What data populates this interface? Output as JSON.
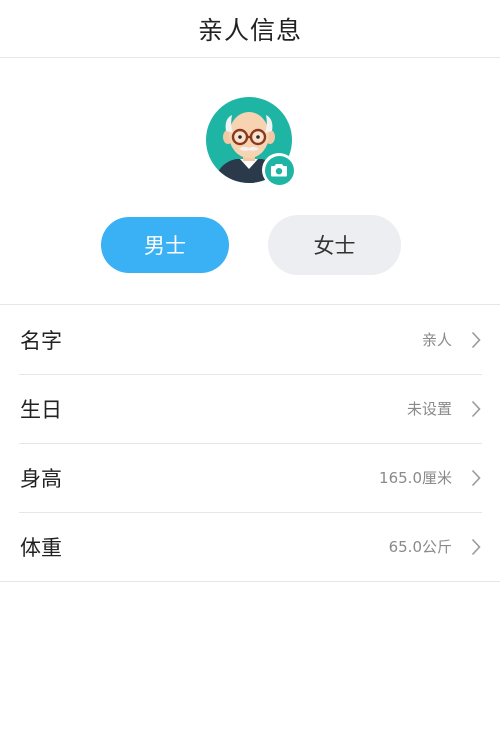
{
  "header": {
    "title": "亲人信息"
  },
  "avatar": {
    "icon": "elderly-man-avatar-icon",
    "badge_icon": "camera-icon",
    "colors": {
      "background": "#1fb5a4",
      "badge": "#1fb5a4"
    }
  },
  "gender": {
    "male_label": "男士",
    "female_label": "女士",
    "selected": "男士",
    "colors": {
      "selected_bg": "#3ab0f5",
      "unselected_bg": "#eceef1"
    }
  },
  "fields": [
    {
      "label": "名字",
      "value": "亲人"
    },
    {
      "label": "生日",
      "value": "未设置"
    },
    {
      "label": "身高",
      "value": "165.0厘米"
    },
    {
      "label": "体重",
      "value": "65.0公斤"
    }
  ]
}
